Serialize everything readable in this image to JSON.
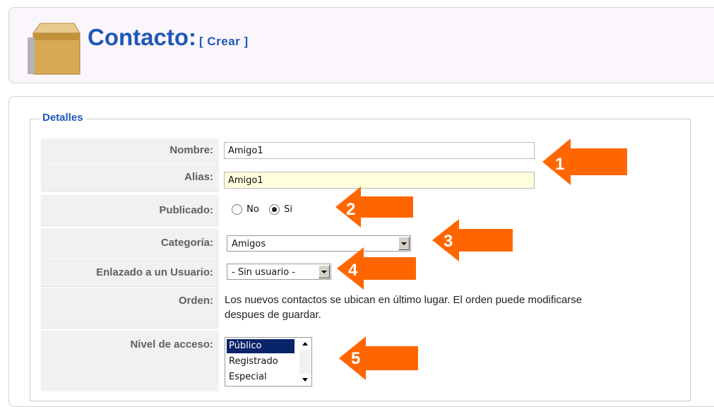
{
  "header": {
    "title": "Contacto:",
    "subtitle": "[ Crear ]",
    "icon": "box-icon"
  },
  "fieldset": {
    "legend": "Detalles"
  },
  "form": {
    "nombre": {
      "label": "Nombre:",
      "value": "Amigo1"
    },
    "alias": {
      "label": "Alias:",
      "value": "Amigo1"
    },
    "publicado": {
      "label": "Publicado:",
      "option_no": "No",
      "option_si": "Si",
      "selected": "Si"
    },
    "categoria": {
      "label": "Categoría:",
      "value": "Amigos"
    },
    "usuario": {
      "label": "Enlazado a un Usuario:",
      "value": "- Sin usuario -"
    },
    "orden": {
      "label": "Orden:",
      "text_line1": "Los nuevos contactos se ubican en último lugar. El orden puede modificarse",
      "text_line2": "despues de guardar."
    },
    "nivel": {
      "label": "Nivel de acceso:",
      "options": [
        "Público",
        "Registrado",
        "Especial"
      ],
      "selected": "Público"
    }
  },
  "annotations": {
    "color": "#ff6600",
    "numbers": [
      "1",
      "2",
      "3",
      "4",
      "5"
    ]
  }
}
